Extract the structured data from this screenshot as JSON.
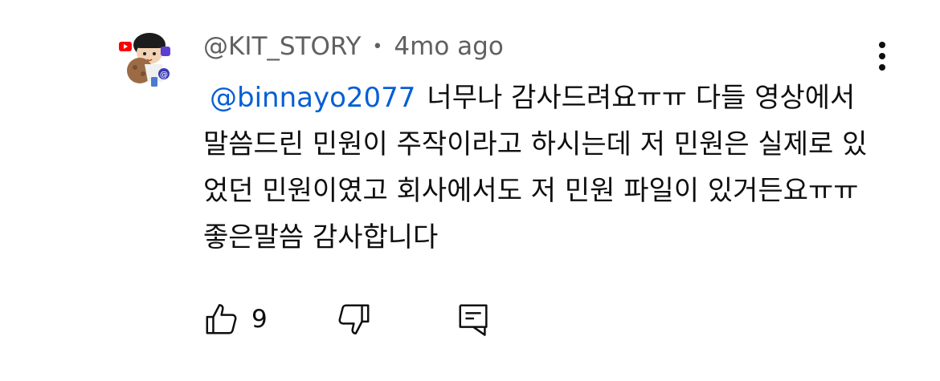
{
  "comment": {
    "author": "@KIT_STORY",
    "separator": "•",
    "time": "4mo ago",
    "mention": "@binnayo2077",
    "text": "너무나 감사드려요ㅠㅠ 다들 영상에서 말씀드린 민원이 주작이라고 하시는데 저 민원은 실제로 있었던 민원이였고 회사에서도 저 민원 파일이 있거든요ㅠㅠ 좋은말씀 감사합니다",
    "like_count": "9"
  },
  "icons": {
    "avatar": "cartoon-character-avatar",
    "menu": "more-vert-icon",
    "like": "thumbs-up-icon",
    "dislike": "thumbs-down-icon",
    "reply": "comment-reply-icon"
  },
  "colors": {
    "mention": "#065fd4",
    "meta": "#606060",
    "text": "#0f0f0f"
  }
}
